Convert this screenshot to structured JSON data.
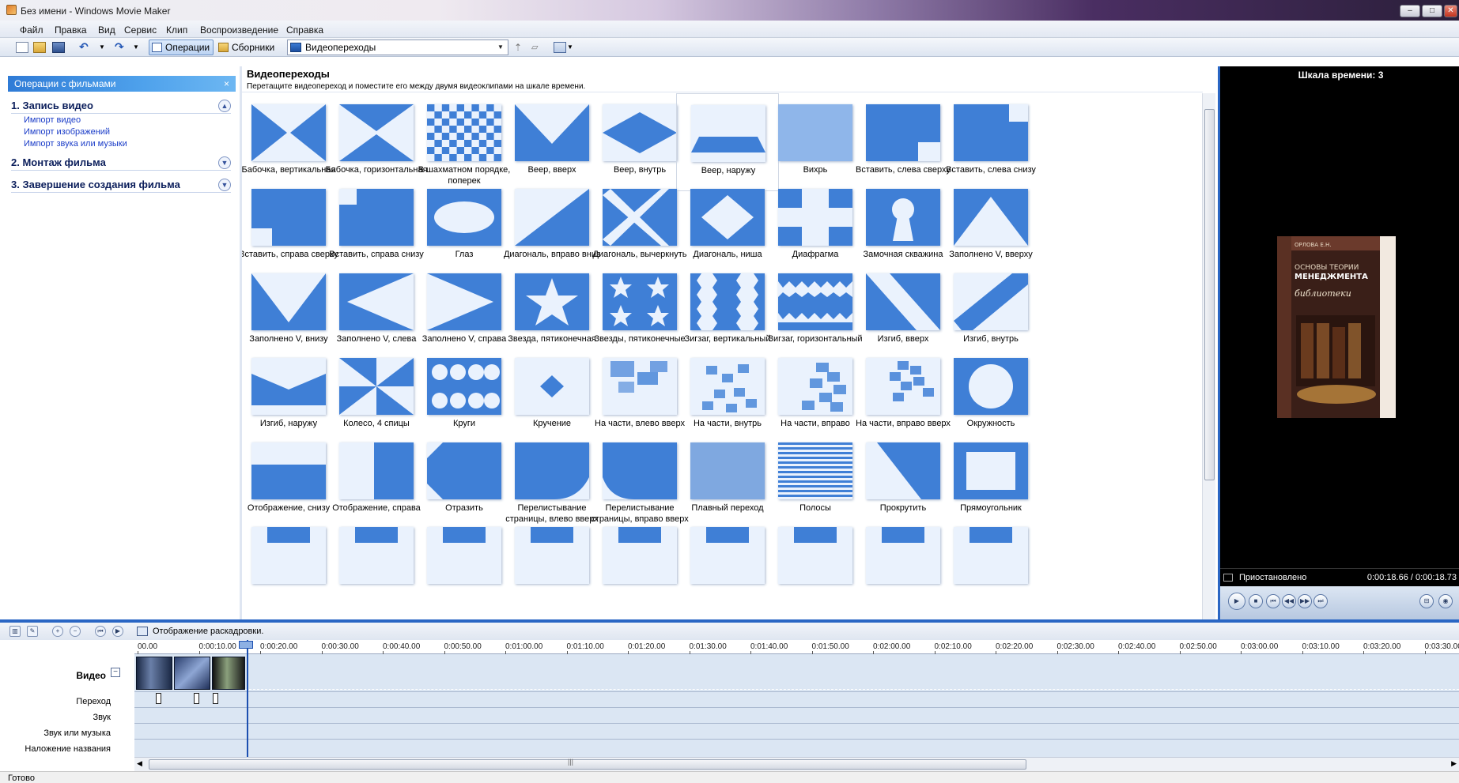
{
  "window": {
    "title": "Без имени - Windows Movie Maker"
  },
  "menu": [
    "Файл",
    "Правка",
    "Вид",
    "Сервис",
    "Клип",
    "Воспроизведение",
    "Справка"
  ],
  "toolbar": {
    "operations_label": "Операции",
    "collections_label": "Сборники",
    "combo_value": "Видеопереходы"
  },
  "tasks": {
    "header": "Операции с фильмами",
    "close": "×",
    "sections": [
      {
        "title": "1. Запись видео",
        "chevron": "▲",
        "links": [
          "Импорт видео",
          "Импорт изображений",
          "Импорт звука или музыки"
        ]
      },
      {
        "title": "2. Монтаж фильма",
        "chevron": "▼"
      },
      {
        "title": "3. Завершение создания фильма",
        "chevron": "▼"
      }
    ]
  },
  "content": {
    "title": "Видеопереходы",
    "hint": "Перетащите видеопереход и поместите его между двумя видеоклипами на шкале времени.",
    "transitions": [
      "Бабочка, вертикальная",
      "Бабочка, горизонтальная",
      "В шахматном порядке, поперек",
      "Веер, вверх",
      "Веер, внутрь",
      "Веер, наружу",
      "Вихрь",
      "Вставить, слева сверху",
      "Вставить, слева снизу",
      "Вставить, справа сверху",
      "Вставить, справа снизу",
      "Глаз",
      "Диагональ, вправо вниз",
      "Диагональ, вычеркнуть",
      "Диагональ, ниша",
      "Диафрагма",
      "Замочная скважина",
      "Заполнено V, вверху",
      "Заполнено V, внизу",
      "Заполнено V, слева",
      "Заполнено V, справа",
      "Звезда, пятиконечная",
      "Звезды, пятиконечные",
      "Зигзаг, вертикальный",
      "Зигзаг, горизонтальный",
      "Изгиб, вверх",
      "Изгиб, внутрь",
      "Изгиб, наружу",
      "Колесо, 4 спицы",
      "Круги",
      "Кручение",
      "На части, влево вверх",
      "На части, внутрь",
      "На части, вправо",
      "На части, вправо вверх",
      "Окружность",
      "Отображение, снизу",
      "Отображение, справа",
      "Отразить",
      "Перелистывание страницы, влево вверх",
      "Перелистывание страницы, вправо вверх",
      "Плавный переход",
      "Полосы",
      "Прокрутить",
      "Прямоугольник"
    ]
  },
  "preview": {
    "title": "Шкала времени: 3",
    "status": "Приостановлено",
    "time": "0:00:18.66 / 0:00:18.73",
    "book": {
      "author": "ОРЛОВА Е.Н.",
      "line1": "ОСНОВЫ ТЕОРИИ",
      "line2": "МЕНЕДЖМЕНТА",
      "line3": "библиотеки"
    }
  },
  "timeline": {
    "toggle_label": "Отображение раскадровки.",
    "ticks": [
      "00.00",
      "0:00:10.00",
      "0:00:20.00",
      "0:00:30.00",
      "0:00:40.00",
      "0:00:50.00",
      "0:01:00.00",
      "0:01:10.00",
      "0:01:20.00",
      "0:01:30.00",
      "0:01:40.00",
      "0:01:50.00",
      "0:02:00.00",
      "0:02:10.00",
      "0:02:20.00",
      "0:02:30.00",
      "0:02:40.00",
      "0:02:50.00",
      "0:03:00.00",
      "0:03:10.00",
      "0:03:20.00",
      "0:03:30.00"
    ],
    "tracks": {
      "video": "Видео",
      "video_toggle": "−",
      "transition": "Переход",
      "audio": "Звук",
      "music": "Звук или музыка",
      "title_overlay": "Наложение названия"
    }
  },
  "statusbar": "Готово",
  "colors": {
    "accent": "#2a66c4",
    "thumb_blue": "#3f7fd6"
  }
}
